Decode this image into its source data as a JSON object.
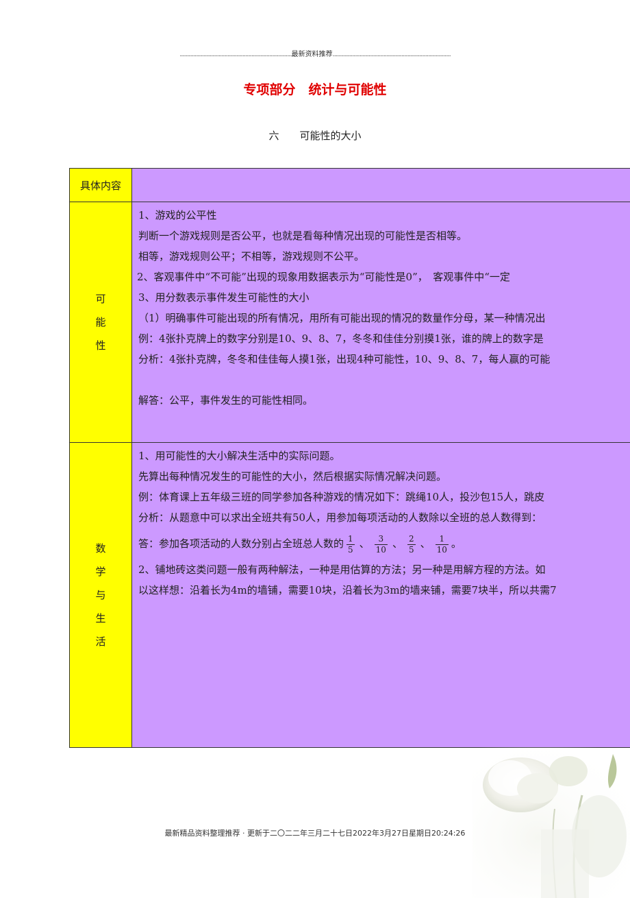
{
  "header": {
    "dots_left": "...........................................................................",
    "label": "最新资料推荐",
    "dots_right": "..............................................................................."
  },
  "title": "专项部分　统计与可能性",
  "subtitle": {
    "num": "六",
    "text": "可能性的大小"
  },
  "table": {
    "header_label": "具体内容",
    "row1": {
      "label_chars": [
        "可",
        "能",
        "性"
      ],
      "lines": [
        "1、游戏的公平性",
        "判断一个游戏规则是否公平，也就是看每种情况出现的可能性是否相等。",
        "相等，游戏规则公平；不相等，游戏规则不公平。",
        "、2、客观事件中“不可能”出现的现象用数据表示为“可能性是0”，　客观事件中“一定",
        "3、用分数表示事件发生可能性的大小",
        "（1）明确事件可能出现的所有情况，用所有可能出现的情况的数量作分母，某一种情况出",
        "例：4张扑克牌上的数字分别是10、9、8、7，冬冬和佳佳分别摸1张，谁的牌上的数字是",
        "分析：4张扑克牌，冬冬和佳佳每人摸1张，出现4种可能性，10、9、8、7，每人赢的可能",
        "解答：公平，事件发生的可能性相同。"
      ]
    },
    "row2": {
      "label_chars": [
        "数",
        "学",
        "与",
        "生",
        "活"
      ],
      "lines": [
        "1、用可能性的大小解决生活中的实际问题。",
        "先算出每种情况发生的可能性的大小，然后根据实际情况解决问题。",
        "例：体育课上五年级三班的同学参加各种游戏的情况如下：跳绳10人，投沙包15人，跳皮",
        "分析：从题意中可以求出全班共有50人，用参加每项活动的人数除以全班的总人数得到：",
        "2、铺地砖这类问题一般有两种解法，一种是用估算的方法；另一种是用解方程的方法。如",
        "以这样想：沿着长为4m的墙铺，需要10块，沿着长为3m的墙来铺，需要7块半，所以共需7"
      ],
      "answer_prefix": "答：参加各项活动的人数分别占全班总人数的",
      "fractions": [
        {
          "n": "1",
          "d": "5"
        },
        {
          "n": "3",
          "d": "10"
        },
        {
          "n": "2",
          "d": "5"
        },
        {
          "n": "1",
          "d": "10"
        }
      ],
      "sep": "、",
      "answer_end": "。"
    }
  },
  "footer": "最新精品资料整理推荐 · 更新于二〇二二年三月二十七日2022年3月27日星期日20:24:26",
  "colors": {
    "title": "#e00000",
    "label_bg": "#ffff00",
    "content_bg": "#cc99ff"
  }
}
